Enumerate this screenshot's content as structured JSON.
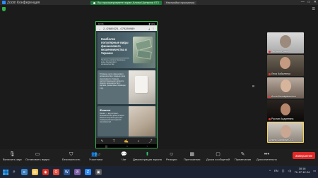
{
  "window": {
    "title": "Zoom Конференция",
    "controls": [
      "—",
      "□",
      "✕"
    ]
  },
  "share_banner": {
    "text": "Вы просматриваете экран Алина Шилкина 073",
    "view_settings": "Настройки просмотра"
  },
  "shared_screen": {
    "status_time": "18:16",
    "status_right": "▮ 52%",
    "url": "2_f2889325...079289989",
    "slide1": {
      "title": "Наиболее популярные виды финансового мошенничества в Украине",
      "subtitle": "Наиболее распространённые виды финансового мошенничества"
    },
    "slide2": {
      "text": "В Украине число финансового мошенничества с каждым годом увеличивается. Самыми распространёнными являются: фишинг, мошенничество с картами, финансовые пирамиды, и др."
    },
    "slide3": {
      "title": "Фишинг",
      "body": "Фишинг — вид интернет-мошенничества, целью которого является получение доступа к конфиденциальным данным пользователей."
    }
  },
  "participants": [
    {
      "name": "Татьяна Рожок",
      "muted": true
    },
    {
      "name": "Леся Кобиленко",
      "muted": true
    },
    {
      "name": "Алла Калаврышенко",
      "muted": true
    },
    {
      "name": "Руслан Андреевна",
      "muted": true
    },
    {
      "name": "Алина Шилкина 073",
      "muted": false
    }
  ],
  "toolbar": {
    "mute": "Включить звук",
    "video": "Остановить видео",
    "security": "Безопасность",
    "participants": "Участники",
    "participants_count": "17",
    "chat": "Чат",
    "share": "Демонстрация экрана",
    "reactions": "Реакции",
    "apps": "Приложения",
    "whiteboard": "Доска сообщений",
    "notes": "Примечания",
    "more": "Дополнительно",
    "end": "Завершение"
  },
  "taskbar": {
    "lang": "EN",
    "time": "18:16",
    "date": "Пт 27.12.24"
  }
}
